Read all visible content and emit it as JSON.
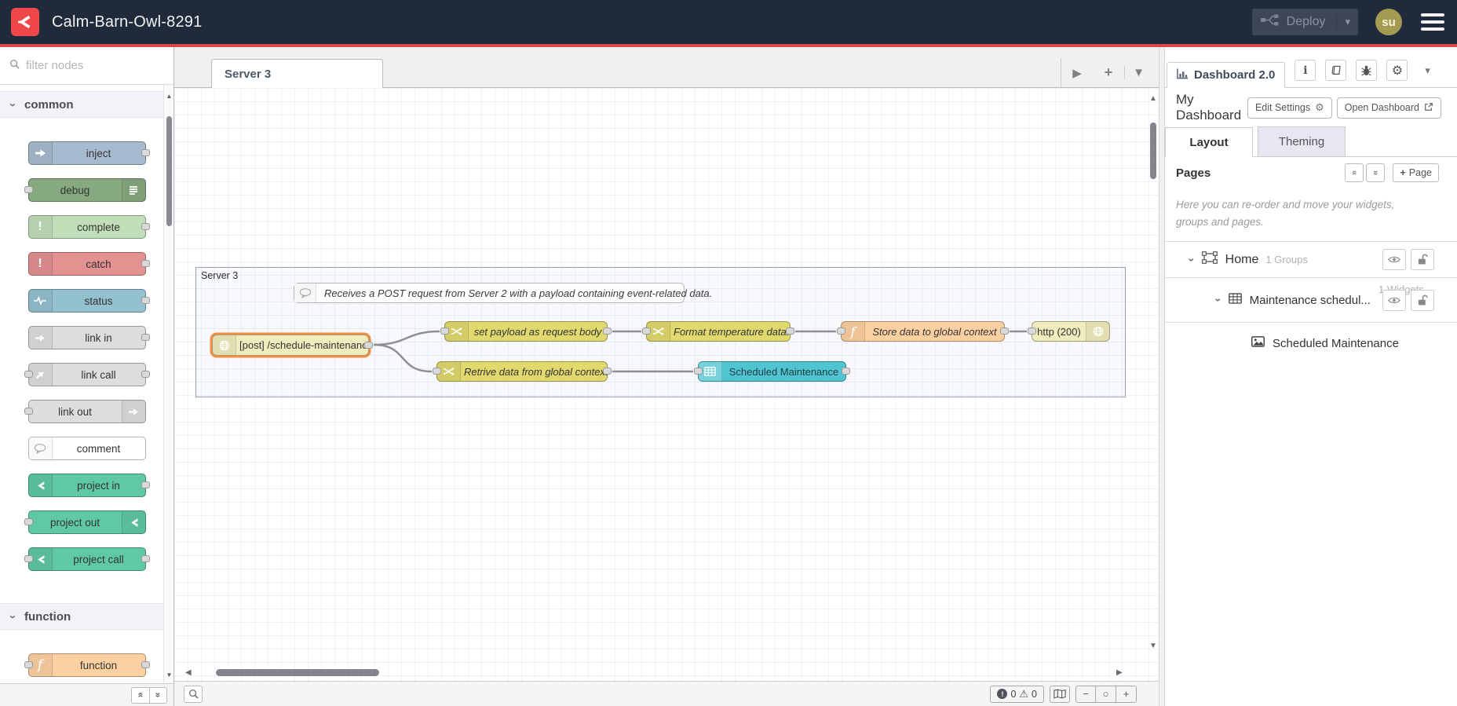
{
  "header": {
    "app_title": "Calm-Barn-Owl-8291",
    "deploy_label": "Deploy",
    "avatar_initials": "su"
  },
  "colors": {
    "header_bg": "#1f2b3a",
    "accent_red": "#e04545",
    "logo_red": "#ef4747",
    "node_inject": "#a6bbcf",
    "node_debug": "#87a980",
    "node_complete": "#c0deb8",
    "node_catch": "#e49191",
    "node_status": "#94c1d0",
    "node_link": "#dddddd",
    "node_comment": "#ffffff",
    "node_project": "#5fc8a7",
    "node_function": "#fdd0a2",
    "node_change": "#e2d96e",
    "node_http": "#f1ecbd",
    "node_ui_table": "#51c4d1",
    "selected_outline": "#fb8c3c"
  },
  "palette": {
    "filter_placeholder": "filter nodes",
    "categories": [
      {
        "label": "common"
      },
      {
        "label": "function"
      }
    ],
    "common_nodes": [
      {
        "label": "inject"
      },
      {
        "label": "debug"
      },
      {
        "label": "complete"
      },
      {
        "label": "catch"
      },
      {
        "label": "status"
      },
      {
        "label": "link in"
      },
      {
        "label": "link call"
      },
      {
        "label": "link out"
      },
      {
        "label": "comment"
      },
      {
        "label": "project in"
      },
      {
        "label": "project out"
      },
      {
        "label": "project call"
      }
    ],
    "function_nodes": [
      {
        "label": "function"
      }
    ]
  },
  "workspace": {
    "active_tab": "Server 3",
    "group_label": "Server 3",
    "comment_text": "Receives a POST request from Server 2 with a payload containing event-related data.",
    "nodes": {
      "http_in": {
        "label": "[post] /schedule-maintenance"
      },
      "set_payload": {
        "label": "set payload as request body"
      },
      "format_temp": {
        "label": "Format temperature data."
      },
      "store_global": {
        "label": "Store data to global context"
      },
      "http_response": {
        "label": "http (200)"
      },
      "retrieve_global": {
        "label": "Retrive data from global context"
      },
      "ui_table": {
        "label": "Scheduled Maintenance"
      }
    },
    "footer": {
      "error_count": "0",
      "warning_count": "0"
    }
  },
  "sidebar": {
    "tab_label": "Dashboard 2.0",
    "dashboard_name": "My Dashboard",
    "edit_settings_label": "Edit Settings",
    "open_dashboard_label": "Open Dashboard",
    "layout_tab": "Layout",
    "theming_tab": "Theming",
    "pages_heading": "Pages",
    "add_page_label": "Page",
    "help_text": "Here you can re-order and move your widgets, groups and pages.",
    "tree": {
      "page_label": "Home",
      "page_meta": "1 Groups",
      "group_label": "Maintenance schedul...",
      "group_meta": "1 Widgets",
      "widget_label": "Scheduled Maintenance"
    }
  }
}
